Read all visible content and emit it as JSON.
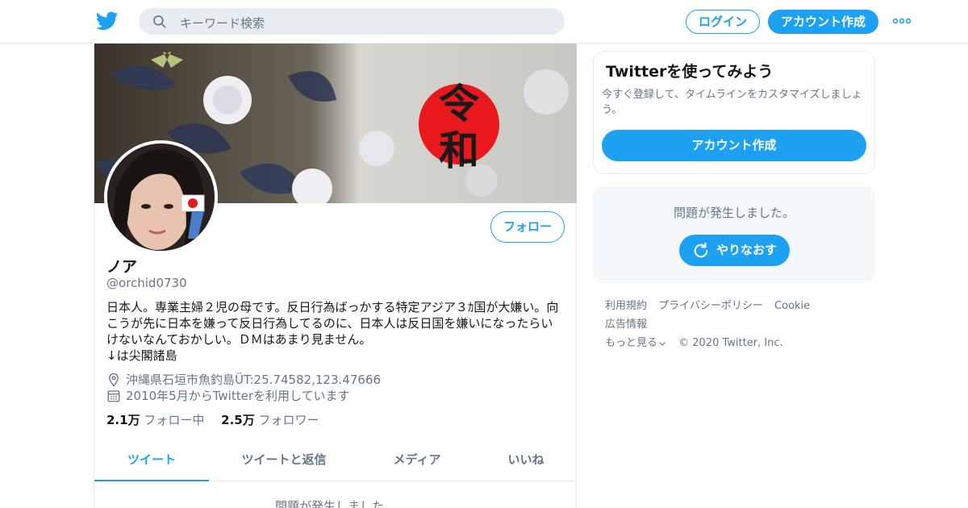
{
  "header": {
    "search_placeholder": "キーワード検索",
    "login_label": "ログイン",
    "signup_label": "アカウント作成"
  },
  "profile": {
    "name": "ノア",
    "handle": "@orchid0730",
    "follow_label": "フォロー",
    "banner_text": "令和",
    "bio_lines": [
      "日本人。専業主婦２児の母です。反日行為ばっかする特定アジア３ｶ国が大嫌い。向",
      "こうが先に日本を嫌って反日行為してるのに、日本人は反日国を嫌いになったらい",
      "けないなんておかしい。ＤＭはあまり見ません。",
      "↓は尖閣諸島"
    ],
    "location": "沖縄県石垣市魚釣島ÜT:25.74582,123.47666",
    "joined": "2010年5月からTwitterを利用しています",
    "following_count": "2.1万",
    "following_label": "フォロー中",
    "followers_count": "2.5万",
    "followers_label": "フォロワー",
    "tabs": [
      "ツイート",
      "ツイートと返信",
      "メディア",
      "いいね"
    ],
    "error_text": "問題が発生しました。"
  },
  "sidebar": {
    "card_title": "Twitterを使ってみよう",
    "card_desc": "今すぐ登録して、タイムラインをカスタマイズしましょう。",
    "card_cta": "アカウント作成",
    "error_text": "問題が発生しました。",
    "retry_label": "やりなおす"
  },
  "footer": {
    "links": [
      "利用規約",
      "プライバシーポリシー",
      "Cookie",
      "広告情報"
    ],
    "more_label": "もっと見る",
    "copyright": "© 2020 Twitter, Inc."
  },
  "colors": {
    "accent": "#1da1f2",
    "secondary_text": "#657786",
    "border": "#e6ecf0",
    "panel_bg": "#f5f8fa"
  },
  "icons": [
    "twitter-bird-icon",
    "search-icon",
    "more-dots-icon",
    "location-pin-icon",
    "calendar-icon",
    "refresh-icon",
    "chevron-down-icon"
  ]
}
